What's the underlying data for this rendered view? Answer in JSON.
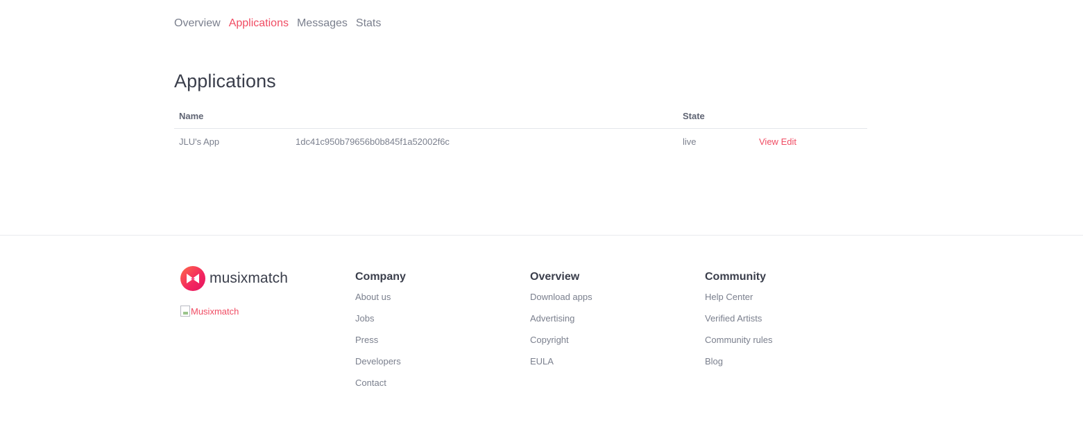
{
  "nav": {
    "items": [
      {
        "label": "Overview",
        "active": false
      },
      {
        "label": "Applications",
        "active": true
      },
      {
        "label": "Messages",
        "active": false
      },
      {
        "label": "Stats",
        "active": false
      }
    ]
  },
  "main": {
    "title": "Applications",
    "table": {
      "headers": {
        "name": "Name",
        "key": "",
        "state": "State",
        "actions": ""
      },
      "rows": [
        {
          "name": "JLU's App",
          "key": "1dc41c950b79656b0b845f1a52002f6c",
          "state": "live",
          "view_label": "View",
          "edit_label": "Edit"
        }
      ]
    }
  },
  "footer": {
    "brand": "musixmatch",
    "broken_image_alt": "Musixmatch",
    "columns": [
      {
        "title": "Company",
        "links": [
          "About us",
          "Jobs",
          "Press",
          "Developers",
          "Contact"
        ]
      },
      {
        "title": "Overview",
        "links": [
          "Download apps",
          "Advertising",
          "Copyright",
          "EULA"
        ]
      },
      {
        "title": "Community",
        "links": [
          "Help Center",
          "Verified Artists",
          "Community rules",
          "Blog"
        ]
      }
    ]
  },
  "colors": {
    "accent": "#f04c63",
    "text_muted": "#7a7f8d",
    "text_dark": "#3a3e4b",
    "divider": "#e4e6ea"
  },
  "icons": {
    "brand_logo": "musixmatch-logo-icon",
    "broken_image": "broken-image-icon"
  }
}
